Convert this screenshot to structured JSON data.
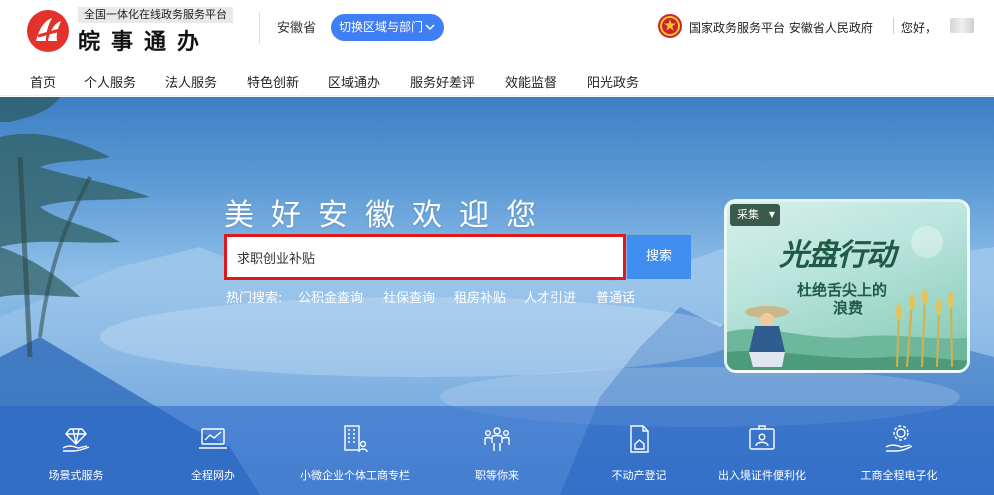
{
  "header": {
    "platform_subtitle": "全国一体化在线政务服务平台",
    "app_name": "皖事通办",
    "province": "安徽省",
    "switch_region_label": "切换区域与部门",
    "national_platform": "国家政务服务平台 安徽省人民政府",
    "greeting": "您好，",
    "accent_color": "#3f7ef5"
  },
  "nav": {
    "items": [
      {
        "label": "首页"
      },
      {
        "label": "个人服务"
      },
      {
        "label": "法人服务"
      },
      {
        "label": "特色创新"
      },
      {
        "label": "区域通办"
      },
      {
        "label": "服务好差评"
      },
      {
        "label": "效能监督"
      },
      {
        "label": "阳光政务"
      }
    ]
  },
  "banner": {
    "welcome": "美好安徽欢迎您",
    "search": {
      "value": "求职创业补贴",
      "button_label": "搜索"
    },
    "hot": {
      "label": "热门搜索:",
      "items": [
        "公积金查询",
        "社保查询",
        "租房补贴",
        "人才引进",
        "普通话"
      ]
    },
    "promo": {
      "tag": "采集",
      "title": "光盘行动",
      "line1": "杜绝舌尖上的",
      "line2": "浪费"
    }
  },
  "services": {
    "items": [
      {
        "label": "场景式服务",
        "icon": "diamond-hand-icon"
      },
      {
        "label": "全程网办",
        "icon": "laptop-chart-icon"
      },
      {
        "label": "小微企业个体工商专栏",
        "icon": "building-people-icon"
      },
      {
        "label": "职等你来",
        "icon": "group-people-icon"
      },
      {
        "label": "不动产登记",
        "icon": "house-document-icon"
      },
      {
        "label": "出入境证件便利化",
        "icon": "id-card-icon"
      },
      {
        "label": "工商全程电子化",
        "icon": "gear-hand-icon"
      }
    ]
  }
}
